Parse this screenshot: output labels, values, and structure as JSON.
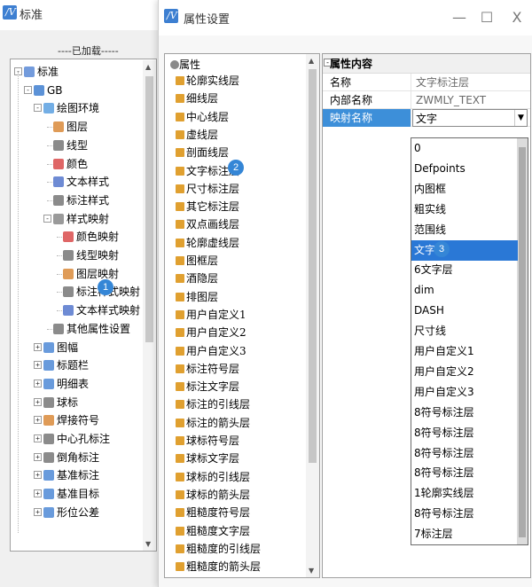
{
  "left_window": {
    "title": "标准",
    "loaded_label": "----已加载-----",
    "tree": [
      {
        "label": "标准",
        "level": 0,
        "toggle": "-",
        "icon": "folder-icon",
        "color": "#5b8ad6"
      },
      {
        "label": "GB",
        "level": 1,
        "toggle": "-",
        "icon": "book-icon",
        "color": "#3f7fd0"
      },
      {
        "label": "绘图环境",
        "level": 2,
        "toggle": "-",
        "icon": "grid-icon",
        "color": "#5aa0e0"
      },
      {
        "label": "图层",
        "level": 3,
        "toggle": "",
        "icon": "layer-icon",
        "color": "#d98a3a"
      },
      {
        "label": "线型",
        "level": 3,
        "toggle": "",
        "icon": "linetype-icon",
        "color": "#777777"
      },
      {
        "label": "颜色",
        "level": 3,
        "toggle": "",
        "icon": "color-icon",
        "color": "#d94b4b"
      },
      {
        "label": "文本样式",
        "level": 3,
        "toggle": "",
        "icon": "text-style-icon",
        "color": "#5577cc"
      },
      {
        "label": "标注样式",
        "level": 3,
        "toggle": "",
        "icon": "dimension-style-icon",
        "color": "#777777"
      },
      {
        "label": "样式映射",
        "level": 3,
        "toggle": "-",
        "icon": "mapping-icon",
        "color": "#888888"
      },
      {
        "label": "颜色映射",
        "level": 4,
        "toggle": "",
        "icon": "color-map-icon",
        "color": "#d94b4b"
      },
      {
        "label": "线型映射",
        "level": 4,
        "toggle": "",
        "icon": "linetype-map-icon",
        "color": "#777777"
      },
      {
        "label": "图层映射",
        "level": 4,
        "toggle": "",
        "icon": "layer-map-icon",
        "color": "#d98a3a"
      },
      {
        "label": "标注样式映射",
        "level": 4,
        "toggle": "",
        "icon": "dimension-map-icon",
        "color": "#777777"
      },
      {
        "label": "文本样式映射",
        "level": 4,
        "toggle": "",
        "icon": "text-map-icon",
        "color": "#5577cc"
      },
      {
        "label": "其他属性设置",
        "level": 3,
        "toggle": "",
        "icon": "settings-icon",
        "color": "#777777"
      },
      {
        "label": "图幅",
        "level": 2,
        "toggle": "+",
        "icon": "frame-icon",
        "color": "#4f8ad6"
      },
      {
        "label": "标题栏",
        "level": 2,
        "toggle": "+",
        "icon": "title-block-icon",
        "color": "#4f8ad6"
      },
      {
        "label": "明细表",
        "level": 2,
        "toggle": "+",
        "icon": "bom-icon",
        "color": "#4f8ad6"
      },
      {
        "label": "球标",
        "level": 2,
        "toggle": "+",
        "icon": "balloon-icon",
        "color": "#777777"
      },
      {
        "label": "焊接符号",
        "level": 2,
        "toggle": "+",
        "icon": "weld-icon",
        "color": "#d98a3a"
      },
      {
        "label": "中心孔标注",
        "level": 2,
        "toggle": "+",
        "icon": "center-hole-icon",
        "color": "#777777"
      },
      {
        "label": "倒角标注",
        "level": 2,
        "toggle": "+",
        "icon": "chamfer-icon",
        "color": "#777777"
      },
      {
        "label": "基准标注",
        "level": 2,
        "toggle": "+",
        "icon": "datum-icon",
        "color": "#4f8ad6"
      },
      {
        "label": "基准目标",
        "level": 2,
        "toggle": "+",
        "icon": "datum-target-icon",
        "color": "#4f8ad6"
      },
      {
        "label": "形位公差",
        "level": 2,
        "toggle": "+",
        "icon": "tolerance-icon",
        "color": "#4f8ad6"
      }
    ]
  },
  "right_window": {
    "title": "属性设置",
    "root_label": "属性",
    "layers": [
      "轮廓实线层",
      "细线层",
      "中心线层",
      "虚线层",
      "剖面线层",
      "文字标注层",
      "尺寸标注层",
      "其它标注层",
      "双点画线层",
      "轮廓虚线层",
      "图框层",
      "酒隐层",
      "排图层",
      "用户自定义1",
      "用户自定义2",
      "用户自定义3",
      "标注符号层",
      "标注文字层",
      "标注的引线层",
      "标注的箭头层",
      "球标符号层",
      "球标文字层",
      "球标的引线层",
      "球标的箭头层",
      "粗糙度符号层",
      "粗糙度文字层",
      "粗糙度的引线层",
      "粗糙度的箭头层"
    ],
    "properties": {
      "header": "属性内容",
      "rows": [
        {
          "key": "名称",
          "value": "文字标注层"
        },
        {
          "key": "内部名称",
          "value": "ZWMLY_TEXT"
        },
        {
          "key": "映射名称",
          "value": "文字"
        }
      ]
    },
    "dropdown_options": [
      "0",
      "Defpoints",
      "内图框",
      "粗实线",
      "范围线",
      "文字",
      "6文字层",
      "dim",
      "DASH",
      "尺寸线",
      "用户自定义1",
      "用户自定义2",
      "用户自定义3",
      "8符号标注层",
      "8符号标注层",
      "8符号标注层",
      "8符号标注层",
      "1轮廓实线层",
      "8符号标注层",
      "7标注层"
    ],
    "selected_option": "文字"
  },
  "callouts": [
    "1",
    "2",
    "3"
  ],
  "window_controls": {
    "minimize": "—",
    "maximize": "☐",
    "close": "X"
  }
}
